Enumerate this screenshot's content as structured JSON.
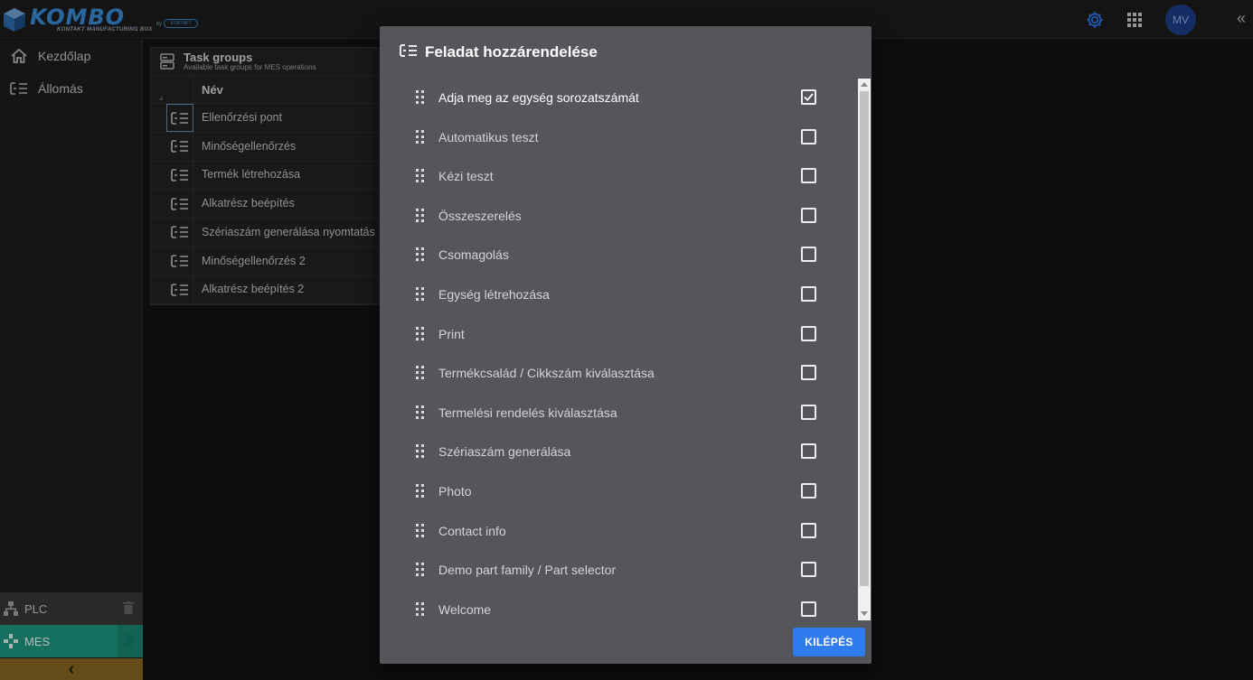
{
  "app": {
    "logo_text": "KOMBO",
    "logo_subtitle": "KONTAKT MANUFACTURING BOX",
    "logo_by": "by",
    "logo_badge": "KONTAKT",
    "user_initials": "MV",
    "collapse_glyph": "«",
    "accent_color": "#2f7cf0"
  },
  "topbar": {
    "icons": [
      "gear-icon",
      "apps-grid-icon"
    ]
  },
  "sidebar": {
    "items": [
      {
        "label": "Kezdőlap",
        "icon": "home-icon"
      },
      {
        "label": "Állomás",
        "icon": "task-list-icon"
      }
    ],
    "bottom": [
      {
        "label": "PLC",
        "icon": "sitemap-icon",
        "color": "#3a3a3a"
      },
      {
        "label": "MES",
        "icon": "gamepad-icon",
        "color": "#1f9c84"
      }
    ],
    "back_glyph": "‹"
  },
  "task_groups": {
    "title": "Task groups",
    "subtitle": "Available task groups for MES operations",
    "column": "Név",
    "rows": [
      "Ellenőrzési pont",
      "Minőségellenőrzés",
      "Termék létrehozása",
      "Alkatrész beépítés",
      "Szériaszám generálása nyomtatás",
      "Minőségellenőrzés 2",
      "Alkatrész beépítés 2"
    ]
  },
  "modal": {
    "title": "Feladat hozzárendelése",
    "items": [
      {
        "label": "Adja meg az egység sorozatszámát",
        "checked": true
      },
      {
        "label": "Automatikus teszt",
        "checked": false
      },
      {
        "label": "Kézi teszt",
        "checked": false
      },
      {
        "label": "Összeszerelés",
        "checked": false
      },
      {
        "label": "Csomagolás",
        "checked": false
      },
      {
        "label": "Egység létrehozása",
        "checked": false
      },
      {
        "label": "Print",
        "checked": false
      },
      {
        "label": "Termékcsalád / Cikkszám kiválasztása",
        "checked": false
      },
      {
        "label": "Termelési rendelés kiválasztása",
        "checked": false
      },
      {
        "label": "Szériaszám generálása",
        "checked": false
      },
      {
        "label": "Photo",
        "checked": false
      },
      {
        "label": "Contact info",
        "checked": false
      },
      {
        "label": "Demo part family / Part selector",
        "checked": false
      },
      {
        "label": "Welcome",
        "checked": false
      }
    ],
    "exit_label": "KILÉPÉS"
  }
}
